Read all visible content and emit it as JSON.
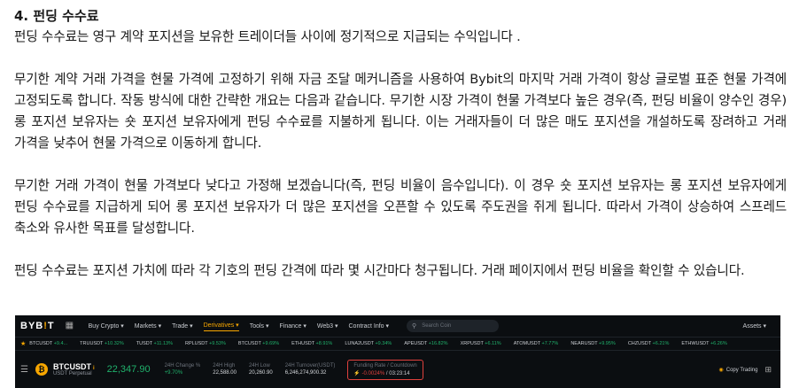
{
  "section": {
    "heading": "4. 펀딩 수수료",
    "paragraphs": [
      "펀딩 수수료는 영구 계약 포지션을 보유한 트레이더들 사이에 정기적으로 지급되는 수익입니다 .",
      "무기한 계약 거래 가격을 현물 가격에 고정하기 위해 자금 조달 메커니즘을 사용하여 Bybit의 마지막 거래 가격이 항상 글로벌 표준 현물 가격에 고정되도록 합니다. 작동 방식에 대한 간략한 개요는 다음과 같습니다. 무기한 시장 가격이 현물 가격보다 높은 경우(즉, 펀딩 비율이 양수인 경우) 롱 포지션 보유자는 숏 포지션 보유자에게 펀딩 수수료를 지불하게 됩니다. 이는 거래자들이 더 많은 매도 포지션을 개설하도록 장려하고 거래 가격을 낮추어 현물 가격으로 이동하게 합니다.",
      "무기한 거래 가격이 현물 가격보다 낮다고 가정해 보겠습니다(즉, 펀딩 비율이 음수입니다). 이 경우 숏 포지션 보유자는 롱 포지션 보유자에게 펀딩 수수료를 지급하게 되어 롱 포지션 보유자가 더 많은 포지션을 오픈할 수 있도록 주도권을 쥐게 됩니다. 따라서 가격이 상승하여 스프레드 축소와 유사한 목표를 달성합니다.",
      "펀딩 수수료는 포지션 가치에 따라 각 기호의 펀딩 간격에 따라 몇 시간마다 청구됩니다. 거래 페이지에서 펀딩 비율을 확인할 수 있습니다."
    ]
  },
  "screenshot": {
    "logo_a": "BYB",
    "logo_b": "!",
    "logo_c": "T",
    "nav": [
      "Buy Crypto ▾",
      "Markets ▾",
      "Trade ▾",
      "Derivatives ▾",
      "Tools ▾",
      "Finance ▾",
      "Web3 ▾",
      "Contract Info ▾"
    ],
    "active_nav": "Derivatives ▾",
    "search_placeholder": "Search Coin",
    "assets_label": "Assets ▾",
    "tickers": [
      {
        "sym": "BTCUSDT",
        "chg": "+9.4..."
      },
      {
        "sym": "TRUUSDT",
        "chg": "+10.32%"
      },
      {
        "sym": "TUSDT",
        "chg": "+11.13%"
      },
      {
        "sym": "RPLUSDT",
        "chg": "+9.53%"
      },
      {
        "sym": "BTCUSDT",
        "chg": "+9.69%"
      },
      {
        "sym": "ETHUSDT",
        "chg": "+8.91%"
      },
      {
        "sym": "LUNA2USDT",
        "chg": "+9.34%"
      },
      {
        "sym": "APEUSDT",
        "chg": "+16.82%"
      },
      {
        "sym": "XRPUSDT",
        "chg": "+6.11%"
      },
      {
        "sym": "ATOMUSDT",
        "chg": "+7.77%"
      },
      {
        "sym": "NEARUSDT",
        "chg": "+9.95%"
      },
      {
        "sym": "CHZUSDT",
        "chg": "+6.21%"
      },
      {
        "sym": "ETHWUSDT",
        "chg": "+6.26%"
      }
    ],
    "pair": {
      "symbol": "BTCUSDT",
      "info": "i",
      "sub": "USDT Perpetual",
      "coin": "₿"
    },
    "price": "22,347.90",
    "stats": [
      {
        "label": "24H Change %",
        "value": "+9.70%",
        "green": true
      },
      {
        "label": "24H High",
        "value": "22,588.00",
        "green": false
      },
      {
        "label": "24H Low",
        "value": "20,260.90",
        "green": false
      },
      {
        "label": "24H Turnover(USDT)",
        "value": "6,246,274,900.32",
        "green": false
      }
    ],
    "funding": {
      "label": "Funding Rate / Countdown",
      "rate": "-0.0024%",
      "countdown": "03:23:14"
    },
    "copy_trading": "Copy Trading"
  }
}
